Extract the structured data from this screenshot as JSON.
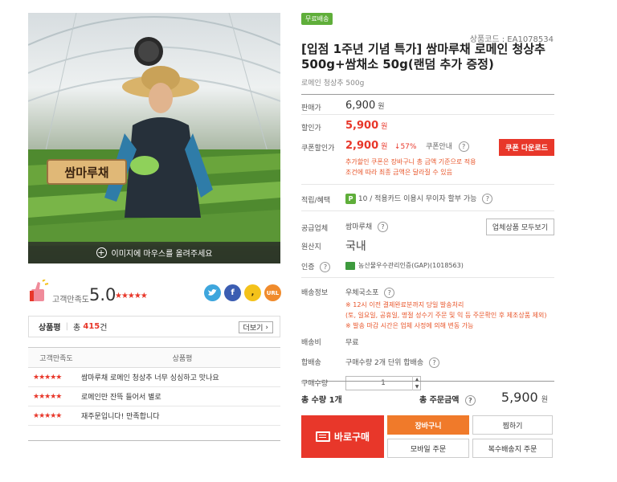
{
  "left": {
    "photo_caption": "이미지에 마우스를 올려주세요",
    "sign_text": "쌈마루채",
    "rating": {
      "label": "고객만족도",
      "score": "5.0",
      "stars": "★★★★★"
    },
    "share": {
      "kakao": ",",
      "url": "URL"
    },
    "reviews": {
      "title": "상품평",
      "total_prefix": "총",
      "count": "415",
      "unit": "건",
      "more": "더보기",
      "col_score": "고객만족도",
      "col_review": "상품평",
      "rows": [
        {
          "stars": "★★★★★",
          "text": "쌈마루채 로메인 청상추 너무 싱싱하고 맛나요"
        },
        {
          "stars": "★★★★★",
          "text": "로메인만 잔뜩 들어서 별로"
        },
        {
          "stars": "★★★★★",
          "text": "재주문입니다! 만족합니다"
        }
      ]
    }
  },
  "product": {
    "badge": "무료배송",
    "code": "상품코드 : EA1078534",
    "title": "[입점 1주년 기념 특가] 쌈마루채 로메인 청상추 500g+쌈채소 50g(랜덤 추가 증정)",
    "subtitle": "로메인 청상추 500g"
  },
  "info": {
    "sale_price": {
      "label": "판매가",
      "value": "6,900",
      "won": "원"
    },
    "discount_price": {
      "label": "할인가",
      "value": "5,900",
      "won": "원"
    },
    "coupon_price": {
      "label": "쿠폰할인가",
      "value": "2,900",
      "won": "원",
      "percent": "↓57%",
      "info": "쿠폰안내",
      "button": "쿠폰 다운로드"
    },
    "coupon_notes": [
      "추가할인 쿠폰은 장바구니 총 금액 기준으로 적용",
      "조건에 따라 최종 금액은 달라질 수 있음"
    ],
    "points": {
      "label": "적립/혜택",
      "badge": "P",
      "value": "10",
      "extra": "/  적용카드 이용시 무이자 할부 가능"
    },
    "seller": {
      "label": "공급업체",
      "value": "쌈마루채",
      "button": "업체상품 모두보기"
    },
    "origin": {
      "label": "원산지",
      "value": "국내"
    },
    "cert": {
      "label": "인증",
      "value": "농산물우수관리인증(GAP)(1018563)"
    },
    "shipping": {
      "label": "배송정보",
      "method": "우체국소포",
      "notes": [
        "※ 12시 이전 결제완료분까지 당일 발송처리",
        "(토, 일요일, 공휴일, 명절 성수기 주문 및 익 등 주문확인 후 제조상품 제외)",
        "※ 발송 마감 시간은 업체 사정에 의해 변동 가능"
      ]
    },
    "shipping_fee": {
      "label": "배송비",
      "value": "무료"
    },
    "bundle": {
      "label": "합배송",
      "value": "구매수량 2개 단위 합배송"
    },
    "quantity": {
      "label": "구매수량",
      "value": "1"
    }
  },
  "total": {
    "qty": "총 수량 1개",
    "amount_label": "총 주문금액",
    "amount": "5,900",
    "won": "원"
  },
  "actions": {
    "buy": "바로구매",
    "cart": "장바구니",
    "wish": "찜하기",
    "mobile": "모바일 주문",
    "multi": "복수배송지 주문"
  },
  "colors": {
    "accent": "#e8372a",
    "orange": "#f07a2a",
    "green": "#5fae3a"
  }
}
